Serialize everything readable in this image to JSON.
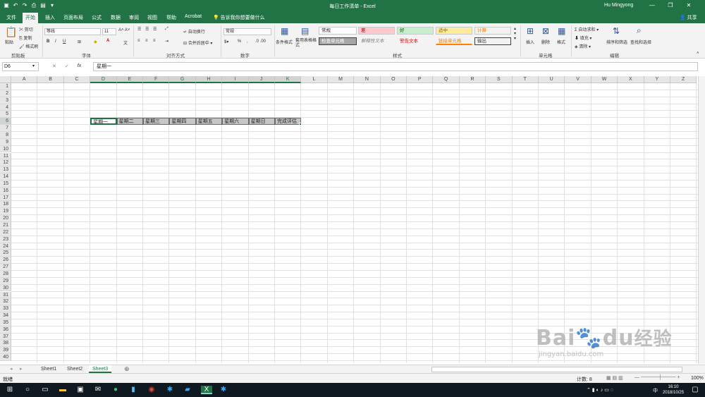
{
  "window": {
    "title": "每日工作清单  -  Excel",
    "user": "Hu Mingyong",
    "share": "共享",
    "minimize_icon": "minimize-icon",
    "restore_icon": "restore-icon",
    "close_icon": "close-icon"
  },
  "tabs": [
    "文件",
    "开始",
    "插入",
    "页面布局",
    "公式",
    "数据",
    "审阅",
    "视图",
    "帮助",
    "Acrobat"
  ],
  "active_tab": "开始",
  "tell_me": "告诉我你想要做什么",
  "ribbon": {
    "clipboard": {
      "paste": "粘贴",
      "cut": "剪切",
      "copy": "复制",
      "format_painter": "格式刷",
      "label": "剪贴板"
    },
    "font": {
      "name": "等线",
      "size": "11",
      "label": "字体"
    },
    "alignment": {
      "wrap": "自动换行",
      "merge": "合并后居中",
      "label": "对齐方式"
    },
    "number": {
      "format": "常规",
      "label": "数字"
    },
    "styles": {
      "conditional": "条件格式",
      "table": "套用表格格式",
      "label": "样式",
      "items": [
        {
          "text": "常规"
        },
        {
          "text": "差"
        },
        {
          "text": "好"
        },
        {
          "text": "适中"
        },
        {
          "text": "计算"
        },
        {
          "text": "检查单元格"
        },
        {
          "text": "解释性文本"
        },
        {
          "text": "警告文本"
        },
        {
          "text": "链接单元格"
        },
        {
          "text": "输出"
        }
      ]
    },
    "cells": {
      "insert": "插入",
      "delete": "删除",
      "format": "格式",
      "label": "单元格"
    },
    "editing": {
      "autosum": "自动求和",
      "fill": "填充",
      "clear": "清除",
      "sort": "排序和筛选",
      "find": "查找和选择",
      "label": "编辑"
    }
  },
  "formula_bar": {
    "name_box": "D6",
    "content": "星期一"
  },
  "columns": [
    "A",
    "B",
    "C",
    "D",
    "E",
    "F",
    "G",
    "H",
    "I",
    "J",
    "K",
    "L",
    "M",
    "N",
    "O",
    "P",
    "Q",
    "R",
    "S",
    "T",
    "U",
    "V",
    "W",
    "X",
    "Y",
    "Z"
  ],
  "rows": [
    "1",
    "2",
    "3",
    "4",
    "5",
    "6",
    "7",
    "8",
    "9",
    "10",
    "11",
    "12",
    "13",
    "14",
    "15",
    "16",
    "17",
    "18",
    "19",
    "20",
    "21",
    "22",
    "23",
    "24",
    "25",
    "26",
    "27",
    "28",
    "29",
    "30",
    "31",
    "32",
    "33",
    "34",
    "35",
    "36",
    "37",
    "38",
    "39",
    "40"
  ],
  "row6_cells": [
    "星期一",
    "星期二",
    "星期三",
    "星期四",
    "星期五",
    "星期六",
    "星期日",
    "完成评估"
  ],
  "sheets": [
    "Sheet1",
    "Sheet2",
    "Sheet3"
  ],
  "active_sheet": "Sheet3",
  "status": {
    "mode": "就绪",
    "count": "计数: 8",
    "zoom": "100%"
  },
  "taskbar": {
    "time": "16:10",
    "date": "2018/10/25",
    "ime": "中"
  },
  "watermark": {
    "text1": "Bai",
    "text2": "du",
    "text3": "经验",
    "url": "jingyan.baidu.com"
  },
  "colors": {
    "excel_green": "#217346",
    "selection_gray": "#c6c6c6"
  }
}
